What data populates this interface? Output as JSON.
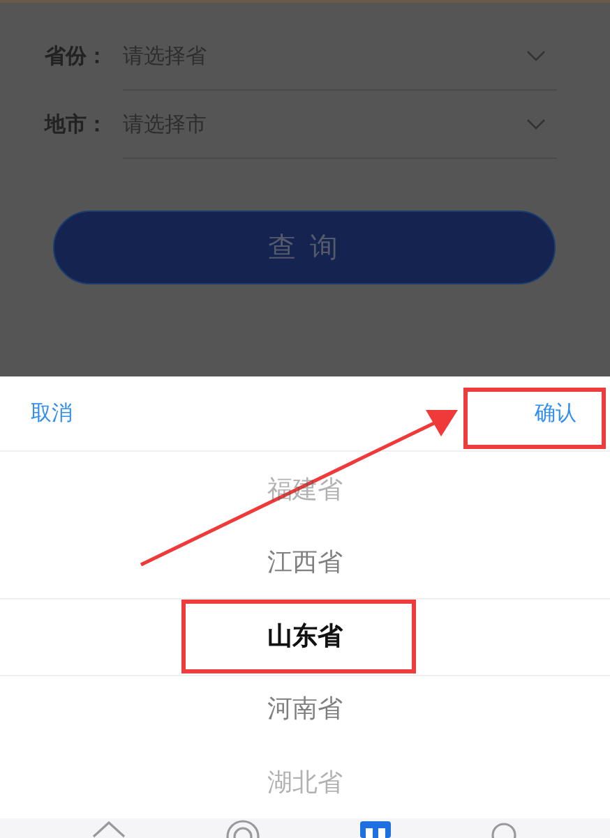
{
  "form": {
    "fields": [
      {
        "label": "省份：",
        "placeholder": "请选择省"
      },
      {
        "label": "地市：",
        "placeholder": "请选择市"
      }
    ],
    "button": "查 询"
  },
  "picker": {
    "cancel": "取消",
    "confirm": "确认",
    "confirm_highlighted": true,
    "items": [
      {
        "label": "福建省",
        "selected": false
      },
      {
        "label": "江西省",
        "selected": false
      },
      {
        "label": "山东省",
        "selected": true
      },
      {
        "label": "河南省",
        "selected": false
      },
      {
        "label": "湖北省",
        "selected": false
      }
    ]
  },
  "annotation_arrow": true,
  "tab_bar": [
    {
      "kind": "home",
      "selected": false
    },
    {
      "kind": "target",
      "selected": false
    },
    {
      "kind": "grid",
      "selected": true
    },
    {
      "kind": "search",
      "selected": false
    }
  ]
}
